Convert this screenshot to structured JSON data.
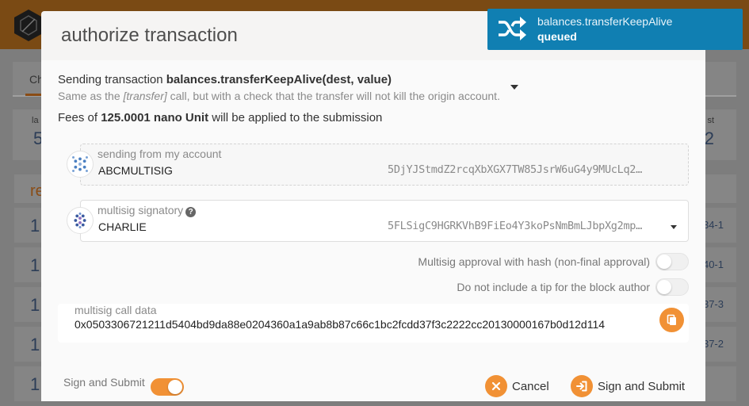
{
  "background": {
    "tab_label": "Ch",
    "stat_left_label": "la",
    "stat_left_value": "5",
    "stat_right_label": "st",
    "stat_right_value": "2",
    "list_title": "re",
    "rows": [
      {
        "num": "1",
        "right": "34-1"
      },
      {
        "num": "1",
        "right": "40-1"
      },
      {
        "num": "1",
        "right": "37-3"
      },
      {
        "num": "1",
        "right": "37-2"
      },
      {
        "num": "1",
        "right": ""
      }
    ]
  },
  "modal": {
    "title": "authorize transaction",
    "tx": {
      "prefix": "Sending transaction ",
      "method": "balances.transferKeepAlive(dest, value)",
      "desc_prefix": "Same as the ",
      "desc_link": "[transfer]",
      "desc_suffix": " call, but with a check that the transfer will not kill the origin account."
    },
    "fees": {
      "prefix": "Fees of ",
      "amount": "125.0001 nano Unit",
      "suffix": " will be applied to the submission"
    },
    "from_account": {
      "label": "sending from my account",
      "name": "ABCMULTISIG",
      "address": "5DjYJStmdZ2rcqXbXGX7TW85JsrW6uG4y9MUcLq2…"
    },
    "signatory": {
      "label": "multisig signatory",
      "name": "CHARLIE",
      "address": "5FLSigC9HGRKVhB9FiEo4Y3koPsNmBmLJbpXg2mp…"
    },
    "toggles": {
      "approval_hash": "Multisig approval with hash (non-final approval)",
      "no_tip": "Do not include a tip for the block author"
    },
    "calldata": {
      "label": "multisig call data",
      "value": "0x0503306721211d5404bd9da88e0204360a1a9ab8b87c66c1bc2fcdd37f3c2222cc20130000167b0d12d114"
    },
    "footer": {
      "toggle_label": "Sign and Submit",
      "cancel_label": "Cancel",
      "submit_label": "Sign and Submit"
    }
  },
  "toast": {
    "title": "balances.transferKeepAlive",
    "status": "queued"
  },
  "colors": {
    "accent": "#f19135",
    "toast_bg": "#107fb2",
    "header_bg": "#7a4a14"
  },
  "state": {
    "approval_hash_on": false,
    "no_tip_on": false,
    "sign_and_submit_on": true
  }
}
